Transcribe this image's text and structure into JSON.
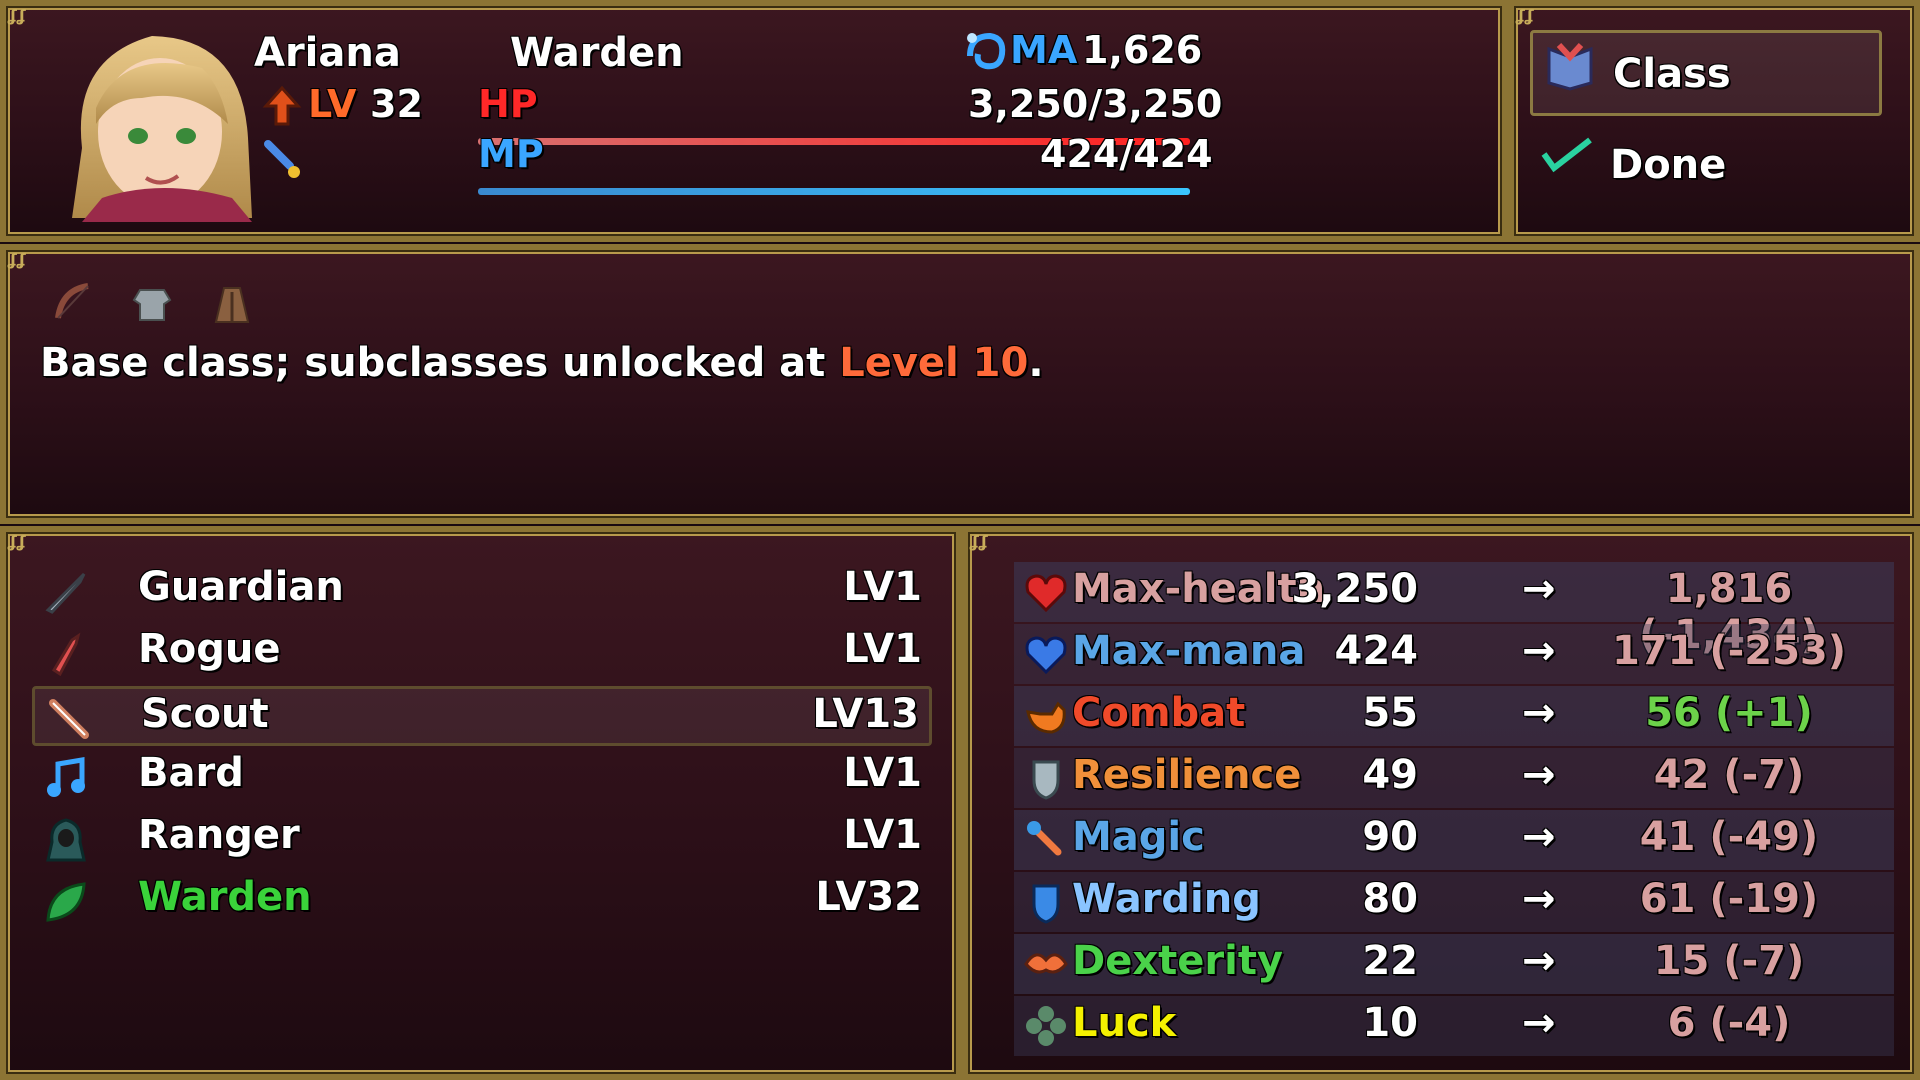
{
  "actor": {
    "name": "Ariana",
    "class": "Warden",
    "level_label": "LV",
    "level": "32",
    "ma_label": "MA",
    "ma_value": "1,626",
    "hp_label": "HP",
    "hp_value": "3,250/3,250",
    "hp_fraction": 1.0,
    "mp_label": "MP",
    "mp_value": "424/424",
    "mp_fraction": 1.0
  },
  "commands": [
    {
      "label": "Class",
      "icon": "spellbook-icon",
      "selected": true
    },
    {
      "label": "Done",
      "icon": "checkmark-icon",
      "selected": false
    }
  ],
  "help": {
    "text_prefix": "Base class; subclasses unlocked at ",
    "text_highlight": "Level 10",
    "text_suffix": ".",
    "equip_icons": [
      "bow-icon",
      "armor-icon",
      "cloak-icon"
    ]
  },
  "classes": [
    {
      "name": "Guardian",
      "level": "LV1",
      "icon": "sword-icon",
      "selected": false,
      "current": false
    },
    {
      "name": "Rogue",
      "level": "LV1",
      "icon": "dagger-icon",
      "selected": false,
      "current": false
    },
    {
      "name": "Scout",
      "level": "LV13",
      "icon": "bow-icon",
      "selected": true,
      "current": false
    },
    {
      "name": "Bard",
      "level": "LV1",
      "icon": "music-note-icon",
      "selected": false,
      "current": false
    },
    {
      "name": "Ranger",
      "level": "LV1",
      "icon": "hooded-figure-icon",
      "selected": false,
      "current": false
    },
    {
      "name": "Warden",
      "level": "LV32",
      "icon": "leaf-icon",
      "selected": false,
      "current": true
    }
  ],
  "stats": [
    {
      "name": "Max-health",
      "old": "3,250",
      "arrow": "→",
      "new": "1,816 (-1,434)",
      "icon": "heart-icon",
      "name_color": "#d8a0a0",
      "new_color": "#d8a0a0"
    },
    {
      "name": "Max-mana",
      "old": "424",
      "arrow": "→",
      "new": "171 (-253)",
      "icon": "mana-icon",
      "name_color": "#5aa6e6",
      "new_color": "#d8a0a0"
    },
    {
      "name": "Combat",
      "old": "55",
      "arrow": "→",
      "new": "56 (+1)",
      "icon": "fist-icon",
      "name_color": "#f04a2a",
      "new_color": "#6cd24a"
    },
    {
      "name": "Resilience",
      "old": "49",
      "arrow": "→",
      "new": "42 (-7)",
      "icon": "shield-icon",
      "name_color": "#f0903a",
      "new_color": "#d8a0a0"
    },
    {
      "name": "Magic",
      "old": "90",
      "arrow": "→",
      "new": "41 (-49)",
      "icon": "wand-icon",
      "name_color": "#5aa6e6",
      "new_color": "#d8a0a0"
    },
    {
      "name": "Warding",
      "old": "80",
      "arrow": "→",
      "new": "61 (-19)",
      "icon": "ward-shield-icon",
      "name_color": "#8ac4ff",
      "new_color": "#d8a0a0"
    },
    {
      "name": "Dexterity",
      "old": "22",
      "arrow": "→",
      "new": "15 (-7)",
      "icon": "feather-icon",
      "name_color": "#4ad24a",
      "new_color": "#d8a0a0"
    },
    {
      "name": "Luck",
      "old": "10",
      "arrow": "→",
      "new": "6 (-4)",
      "icon": "clover-icon",
      "name_color": "#f4f000",
      "new_color": "#d8a0a0"
    }
  ],
  "colors": {
    "hp_label": "#ff2828",
    "mp_label": "#3aa6ff",
    "level_label": "#ff6a2a",
    "ma_label": "#3aa6ff",
    "help_highlight": "#ff6a3a",
    "current_class": "#3ad23a",
    "frame_gold": "#8c7434"
  }
}
